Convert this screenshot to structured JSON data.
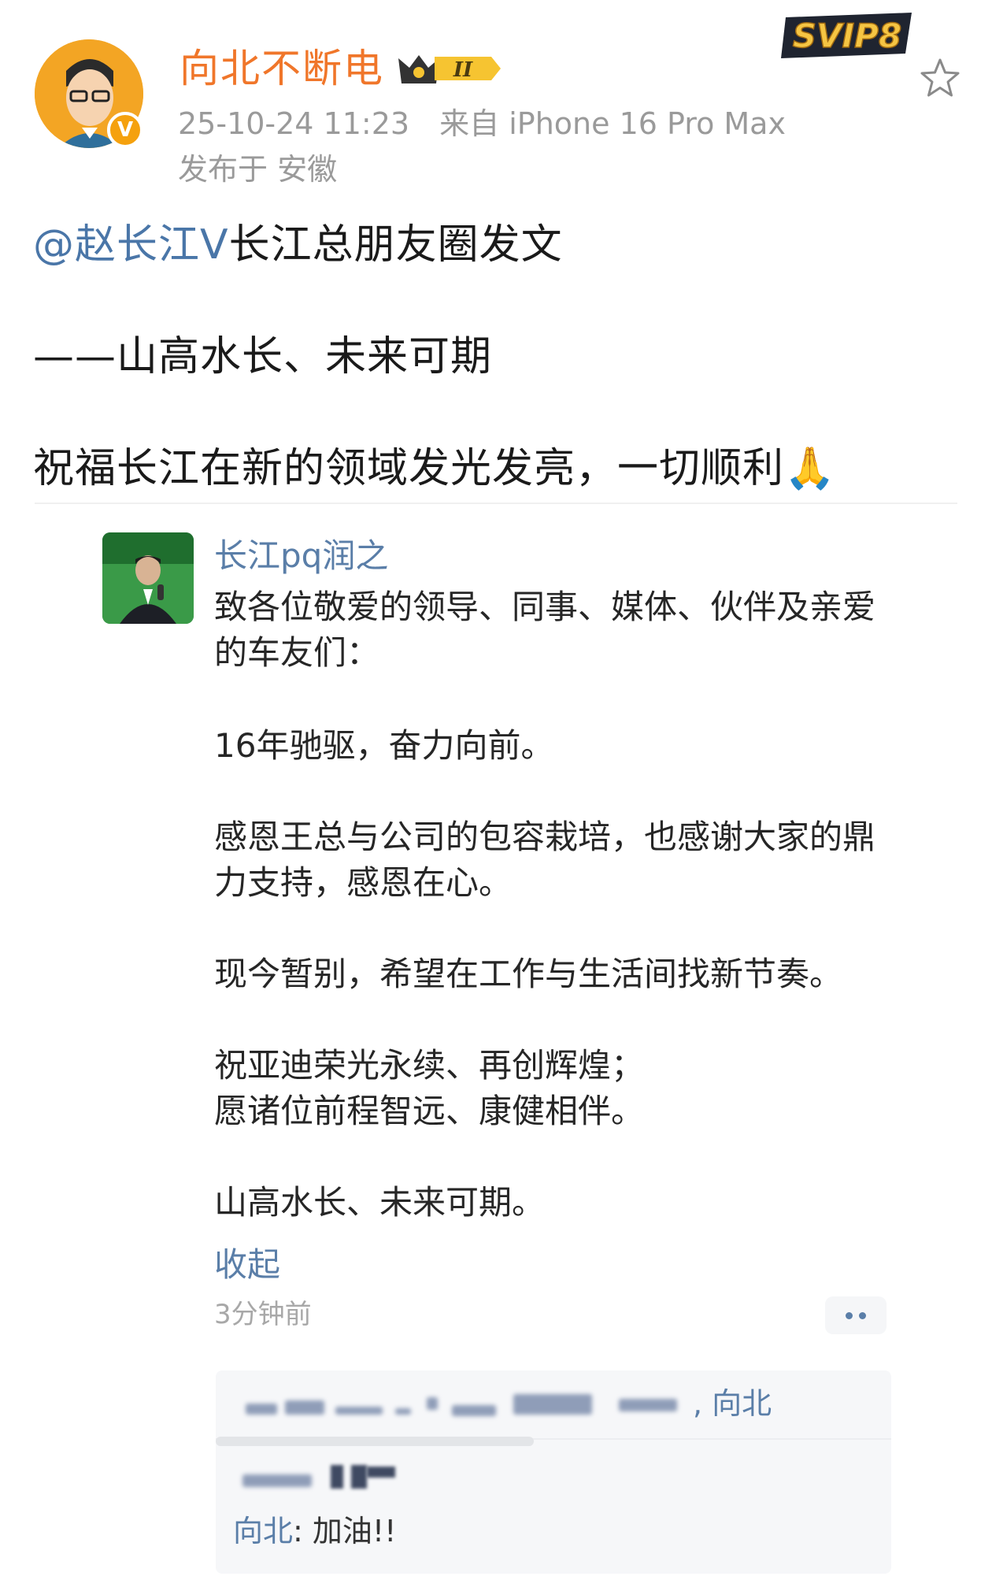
{
  "header": {
    "username": "向北不断电",
    "level_badge": "II",
    "timestamp": "25-10-24 11:23",
    "source": "来自 iPhone 16 Pro Max",
    "location": "发布于 安徽",
    "svip_badge": "SVIP8",
    "verified_mark": "V"
  },
  "post": {
    "mention": "@赵长江V",
    "line1_rest": "长江总朋友圈发文",
    "line2": "——山高水长、未来可期",
    "line3": "祝福长江在新的领域发光发亮，一切顺利🙏"
  },
  "quoted": {
    "author": "长江pq润之",
    "lines": [
      "致各位敬爱的领导、同事、媒体、伙伴及亲爱",
      "的车友们：",
      "16年驰驱，奋力向前。",
      "感恩王总与公司的包容栽培，也感谢大家的鼎",
      "力支持，感恩在心。",
      "现今暂别，希望在工作与生活间找新节奏。",
      "祝亚迪荣光永续、再创辉煌；",
      "愿诸位前程智远、康健相伴。",
      "山高水长、未来可期。"
    ],
    "collapse_label": "收起",
    "time_ago": "3分钟前"
  },
  "comments": {
    "likes_suffix": ", 向北",
    "items": [
      {
        "author": "向北",
        "text": ": 加油!!"
      }
    ]
  },
  "colors": {
    "username": "#f0762a",
    "link": "#5a7ea8",
    "meta": "#9a9a9a",
    "verified": "#f5a10e"
  },
  "icons": {
    "star": "star-icon",
    "more": "more-dots-icon",
    "crown": "crown-icon"
  }
}
